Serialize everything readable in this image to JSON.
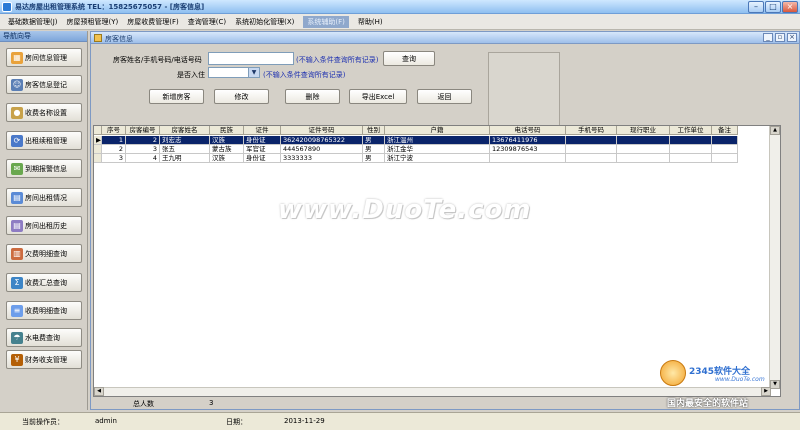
{
  "window": {
    "title": "易达房屋出租管理系统 TEL：15825675057 - [房客信息]"
  },
  "menu": [
    "基础数据管理(J)",
    "房屋预租管理(Y)",
    "房屋收费管理(F)",
    "查询管理(C)",
    "系统初始化管理(X)",
    "系统辅助(F)",
    "帮助(H)"
  ],
  "menu_active_index": 5,
  "nav": {
    "header": "导航向导",
    "items": [
      {
        "label": "房间信息管理",
        "icon": "building-icon"
      },
      {
        "label": "房客信息登记",
        "icon": "person-icon"
      },
      {
        "label": "收费名称设置",
        "icon": "coin-icon"
      },
      {
        "label": "出租续租管理",
        "icon": "rent-icon"
      },
      {
        "label": "到期报警信息",
        "icon": "alarm-icon"
      },
      {
        "label": "房间出租情况",
        "icon": "room-icon"
      },
      {
        "label": "房间出租历史",
        "icon": "history-icon"
      },
      {
        "label": "欠费明细查询",
        "icon": "arrears-icon"
      },
      {
        "label": "收费汇总查询",
        "icon": "summary-icon"
      },
      {
        "label": "收费明细查询",
        "icon": "detail-icon"
      },
      {
        "label": "水电费查询",
        "icon": "utility-icon"
      },
      {
        "label": "财务收支管理",
        "icon": "finance-icon"
      }
    ]
  },
  "panel": {
    "title": "房客信息"
  },
  "form": {
    "search_label": "房客姓名/手机号码/电话号码",
    "search_value": "",
    "search_hint": "(不输入条件查询所有记录)",
    "checkin_label": "是否入住",
    "checkin_value": "",
    "checkin_hint": "(不输入条件查询所有记录)",
    "query_button": "查询",
    "buttons": {
      "add": "新增房客",
      "edit": "修改",
      "delete": "删除",
      "export": "导出Excel",
      "back": "返回"
    }
  },
  "grid": {
    "columns": [
      "序号",
      "房客编号",
      "房客姓名",
      "民族",
      "证件",
      "证件号码",
      "性别",
      "户籍",
      "电话号码",
      "手机号码",
      "现行职业",
      "工作单位",
      "备注"
    ],
    "rows": [
      [
        "1",
        "2",
        "刘宏志",
        "汉族",
        "身份证",
        "362420098765322",
        "男",
        "浙江温州",
        "13676411976",
        "",
        "",
        "",
        ""
      ],
      [
        "2",
        "3",
        "张五",
        "蒙古族",
        "军官证",
        "444567890",
        "男",
        "浙江金华",
        "12309876543",
        "",
        "",
        "",
        ""
      ],
      [
        "3",
        "4",
        "王九明",
        "汉族",
        "身份证",
        "3333333",
        "男",
        "浙江宁波",
        "",
        "",
        "",
        "",
        ""
      ]
    ],
    "selected_row": 0
  },
  "totals": {
    "label": "总人数",
    "value": "3"
  },
  "status": {
    "operator_label": "当前操作员：",
    "operator": "admin",
    "date_label": "日期：",
    "date": "2013-11-29"
  },
  "watermark": {
    "text": "www.DuoTe.com"
  },
  "corner_logo": {
    "brand": "2345软件大全",
    "url": "www.DuoTe.com",
    "slogan": "国内最安全的软件站"
  }
}
